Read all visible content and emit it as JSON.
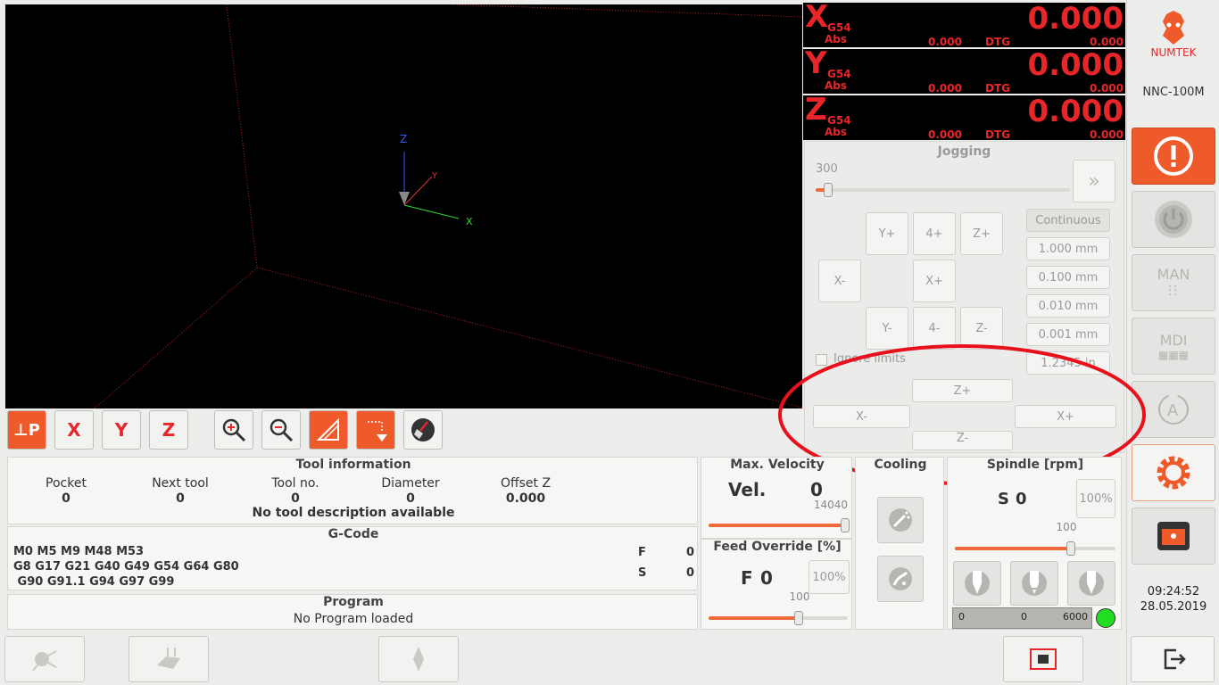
{
  "viewport": {
    "axis_x": "X",
    "axis_y": "Y",
    "axis_z": "Z"
  },
  "dro": [
    {
      "axis": "X",
      "cs": "G54",
      "abs_label": "Abs",
      "value": "0.000",
      "abs_value": "0.000",
      "dtg_label": "DTG",
      "dtg_value": "0.000"
    },
    {
      "axis": "Y",
      "cs": "G54",
      "abs_label": "Abs",
      "value": "0.000",
      "abs_value": "0.000",
      "dtg_label": "DTG",
      "dtg_value": "0.000"
    },
    {
      "axis": "Z",
      "cs": "G54",
      "abs_label": "Abs",
      "value": "0.000",
      "abs_value": "0.000",
      "dtg_label": "DTG",
      "dtg_value": "0.000"
    }
  ],
  "brand": {
    "name": "NUMTEK",
    "model": "NNC-100M",
    "accent": "#e8262a"
  },
  "jogging": {
    "title": "Jogging",
    "speed": "300",
    "speed_fraction": 0.05,
    "buttons": {
      "yplus": "Y+",
      "fourplus": "4+",
      "zplus": "Z+",
      "xminus": "X-",
      "xplus": "X+",
      "yminus": "Y-",
      "fourminus": "4-",
      "zminus": "Z-"
    },
    "increments": [
      "Continuous",
      "1.000 mm",
      "0.100 mm",
      "0.010 mm",
      "0.001 mm",
      "1.2345 in"
    ],
    "ignore_limits": "Ignore limits",
    "lower": {
      "zplus": "Z+",
      "xminus": "X-",
      "xplus": "X+",
      "zminus": "Z-"
    }
  },
  "sidebar": {
    "man": "MAN",
    "mdi": "MDI",
    "time": "09:24:52",
    "date": "28.05.2019"
  },
  "tool_info": {
    "title": "Tool information",
    "pocket_label": "Pocket",
    "pocket": "0",
    "next_tool_label": "Next tool",
    "next_tool": "0",
    "tool_no_label": "Tool no.",
    "tool_no": "0",
    "diameter_label": "Diameter",
    "diameter": "0",
    "offset_z_label": "Offset Z",
    "offset_z": "0.000",
    "description": "No tool description available"
  },
  "gcode": {
    "title": "G-Code",
    "line1": "M0 M5 M9 M48 M53",
    "line2": "G8 G17 G21 G40 G49 G54 G64 G80",
    "line3": " G90 G91.1 G94 G97 G99",
    "f_label": "F",
    "f_value": "0",
    "s_label": "S",
    "s_value": "0"
  },
  "program": {
    "title": "Program",
    "status": "No Program loaded"
  },
  "velocity": {
    "title": "Max. Velocity",
    "label": "Vel.",
    "value": "0",
    "max": "14040",
    "fraction": 0.98
  },
  "feed": {
    "title": "Feed Override [%]",
    "label": "F",
    "value": "0",
    "percent_btn": "100%",
    "scale": "100",
    "fraction": 0.65
  },
  "cooling": {
    "title": "Cooling"
  },
  "spindle": {
    "title": "Spindle [rpm]",
    "label": "S",
    "value": "0",
    "percent_btn": "100%",
    "scale": "100",
    "fraction": 0.72,
    "bar_min": "0",
    "bar_value": "0",
    "bar_max": "6000",
    "status_color": "#22dd22"
  }
}
